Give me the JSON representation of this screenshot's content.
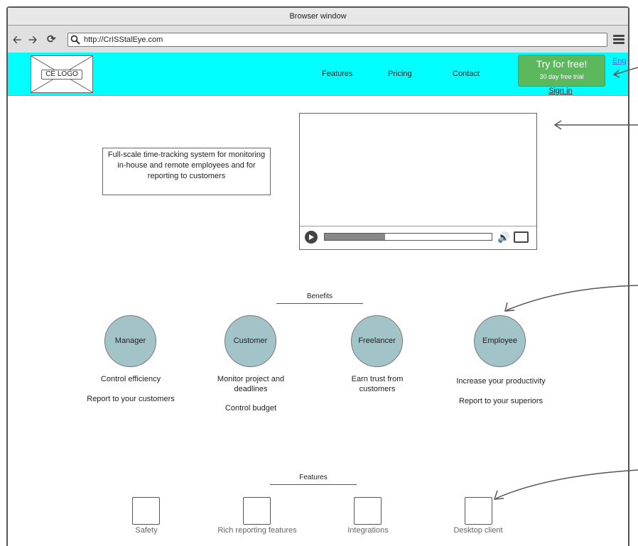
{
  "window": {
    "title": "Browser window"
  },
  "toolbar": {
    "url": "http://CrISStalEye.com"
  },
  "header": {
    "logo_text": "CE LOGO",
    "nav": [
      "Features",
      "Pricing",
      "Contact"
    ],
    "cta_title": "Try for free!",
    "cta_subtitle": "30 day free trial",
    "signin": "Sign in",
    "language": "Eng"
  },
  "hero": {
    "tagline": "Full-scale time-tracking system for monitoring in-house and remote employees and for reporting to customers",
    "video_progress": 0.36
  },
  "benefits": {
    "title": "Benefits",
    "items": [
      {
        "role": "Manager",
        "lines": [
          "Control efficiency",
          "Report to your customers"
        ]
      },
      {
        "role": "Customer",
        "lines": [
          "Monitor project and deadlines",
          "Control budget"
        ]
      },
      {
        "role": "Freelancer",
        "lines": [
          "Earn trust from customers"
        ]
      },
      {
        "role": "Employee",
        "lines": [
          "Increase your productivity",
          "Report to your superiors"
        ]
      }
    ]
  },
  "features": {
    "title": "Features",
    "items": [
      "Safety",
      "Rich reporting features",
      "Integrations",
      "Desktop client"
    ]
  },
  "colors": {
    "header_bg": "#00ffff",
    "cta_bg": "#5cb85c",
    "circle_bg": "#a2c4c9"
  }
}
